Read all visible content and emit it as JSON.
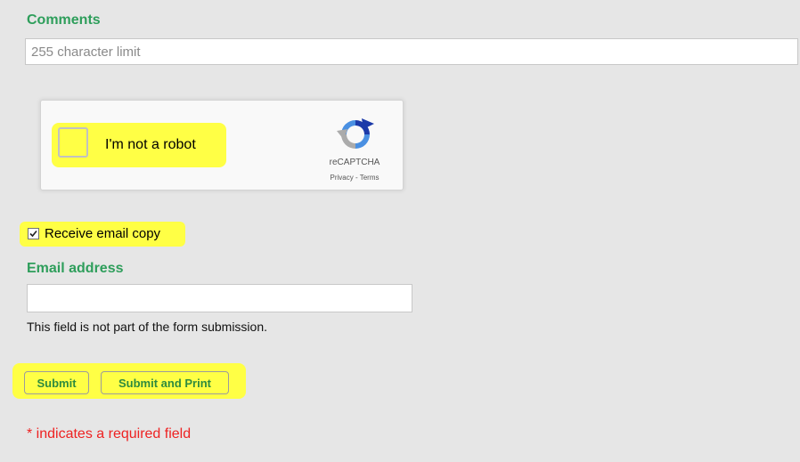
{
  "comments": {
    "label": "Comments",
    "placeholder": "255 character limit",
    "value": ""
  },
  "recaptcha": {
    "checkbox_label": "I'm not a robot",
    "brand": "reCAPTCHA",
    "privacy": "Privacy",
    "separator": " - ",
    "terms": "Terms",
    "icon": "recaptcha-logo-icon"
  },
  "email_copy": {
    "label": "Receive email copy",
    "checked": true
  },
  "email": {
    "label": "Email address",
    "value": "",
    "note": "This field is not part of the form submission."
  },
  "buttons": {
    "submit": "Submit",
    "submit_print": "Submit and Print"
  },
  "footer": {
    "required_note": "* indicates a required field"
  },
  "colors": {
    "label_green": "#2e9e5b",
    "highlight_yellow": "#ffff45",
    "required_red": "#ee2222",
    "panel_bg": "#e6e6e6"
  }
}
